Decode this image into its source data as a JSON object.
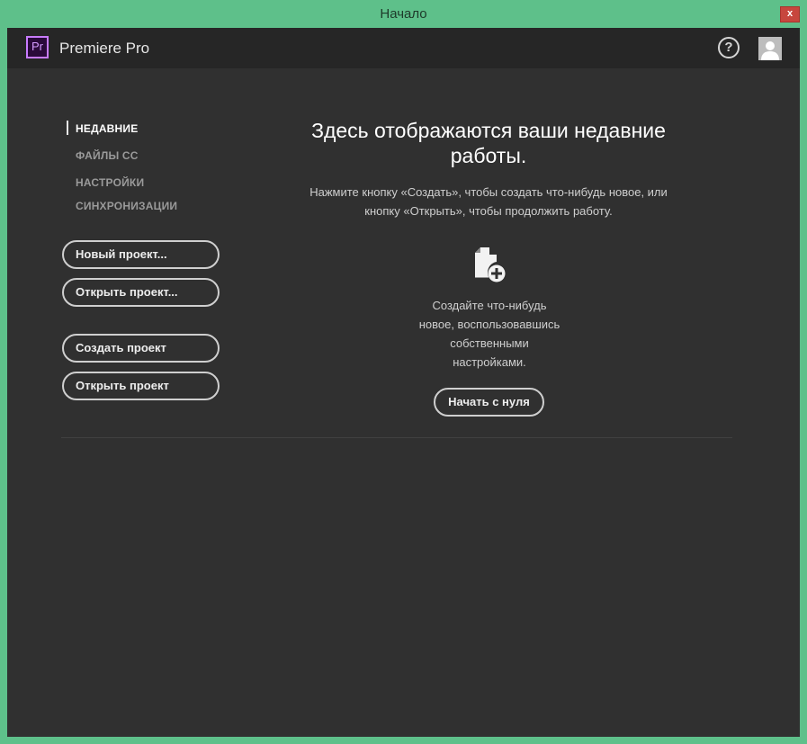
{
  "window": {
    "title": "Начало",
    "close_glyph": "x"
  },
  "header": {
    "logo_text": "Pr",
    "app_name": "Premiere Pro",
    "help_glyph": "?"
  },
  "nav": {
    "items": [
      {
        "label": "НЕДАВНИЕ",
        "active": true
      },
      {
        "label": "ФАЙЛЫ CC",
        "active": false
      },
      {
        "label": "НАСТРОЙКИ",
        "active": false
      },
      {
        "label": "СИНХРОНИЗАЦИИ",
        "active": false
      }
    ]
  },
  "buttons": {
    "new_project": "Новый проект...",
    "open_project_dots": "Открыть проект...",
    "create_project": "Создать проект",
    "open_project": "Открыть проект"
  },
  "main": {
    "headline_line1": "Здесь отображаются ваши недавние",
    "headline_line2": "работы.",
    "subtext_line1": "Нажмите кнопку «Создать», чтобы создать что-нибудь новое, или",
    "subtext_line2": "кнопку «Открыть», чтобы продолжить работу.",
    "create_line1": "Создайте что-нибудь",
    "create_line2": "новое, воспользовавшись",
    "create_line3": "собственными",
    "create_line4": "настройками.",
    "start_button": "Начать с нуля"
  },
  "icons": {
    "logo": "premiere-pro-logo",
    "help": "help-icon",
    "avatar": "user-avatar-icon",
    "file_add": "file-add-icon",
    "close": "close-icon"
  },
  "colors": {
    "window_frame": "#5ec08a",
    "background": "#303030",
    "header": "#262626",
    "logo_border": "#c87bff",
    "close_button": "#c7463e"
  }
}
